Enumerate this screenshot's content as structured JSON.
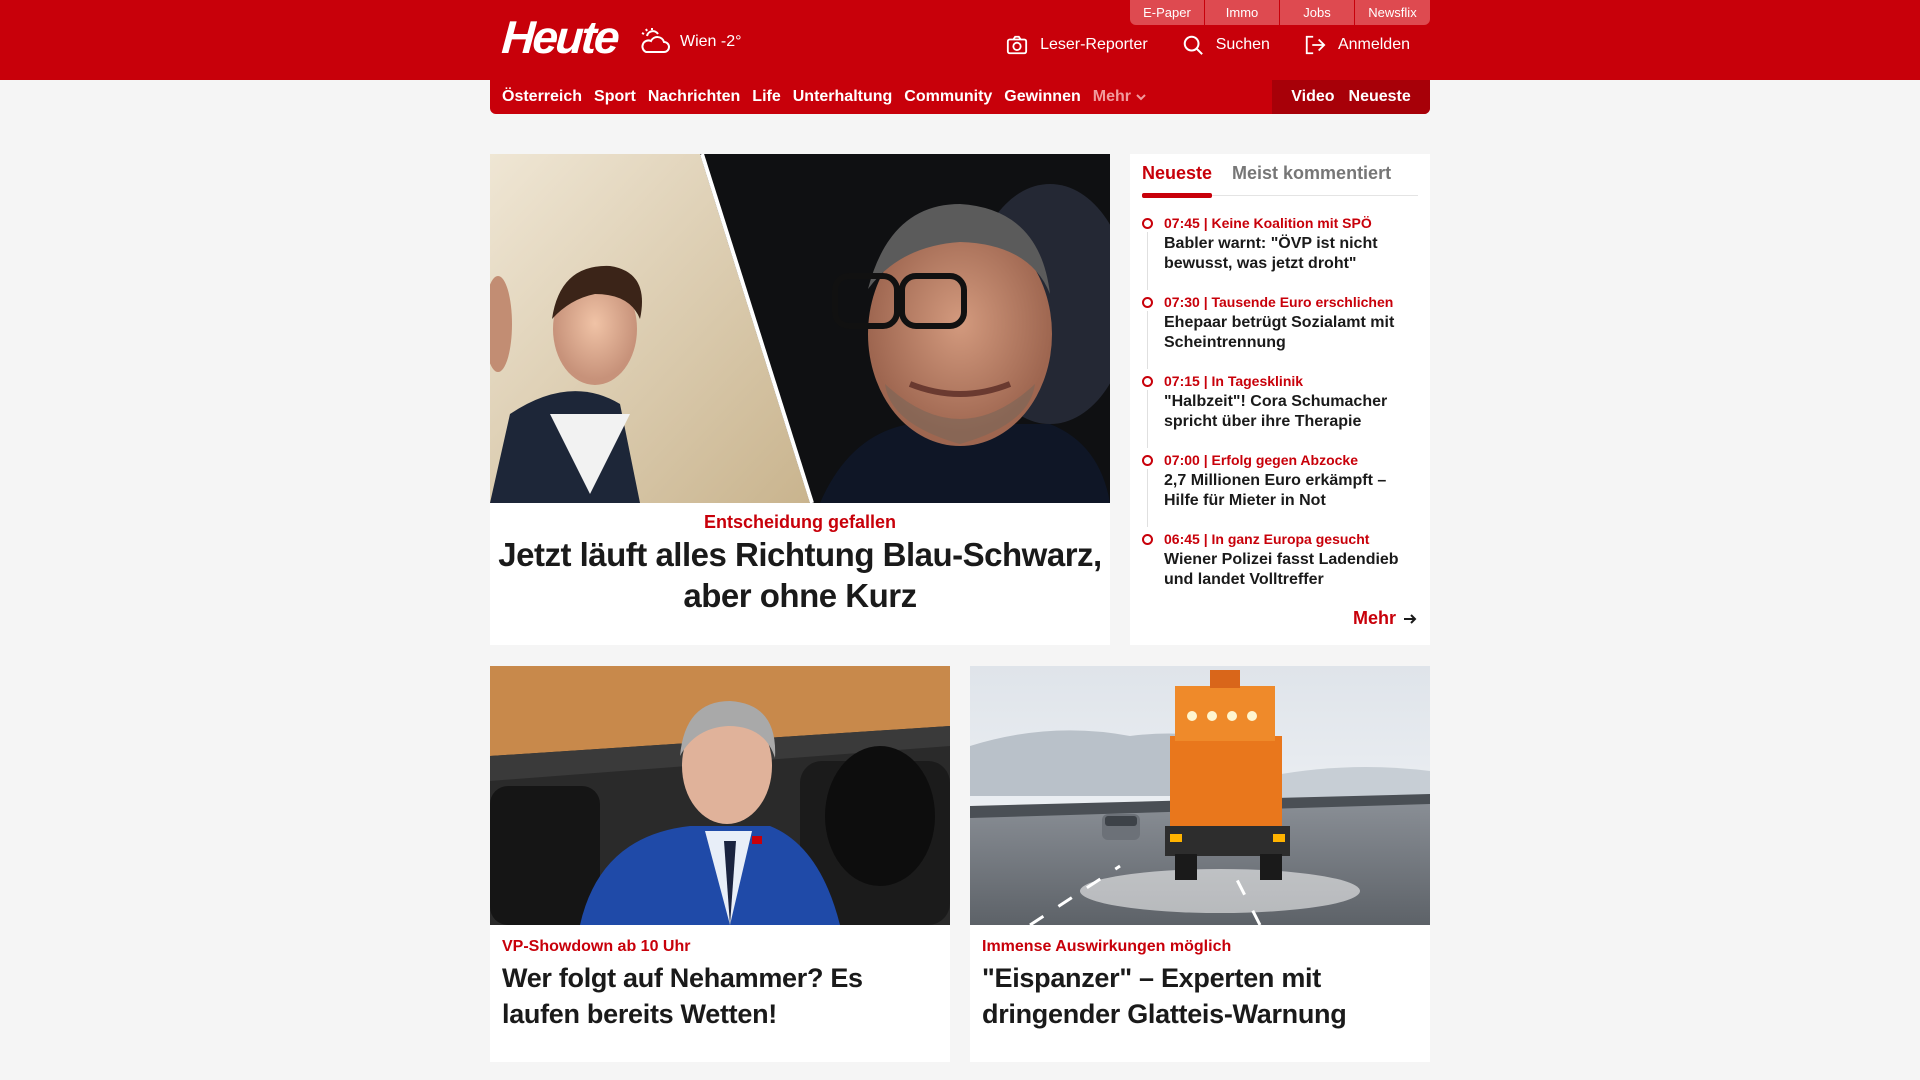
{
  "header": {
    "logo": "Heute",
    "weather": "Wien -2°",
    "utility_tabs": [
      "E-Paper",
      "Immo",
      "Jobs",
      "Newsflix"
    ],
    "actions": {
      "reporter": "Leser-Reporter",
      "search": "Suchen",
      "login": "Anmelden"
    }
  },
  "nav": {
    "items": [
      "Österreich",
      "Sport",
      "Nachrichten",
      "Life",
      "Unterhaltung",
      "Community",
      "Gewinnen"
    ],
    "more": "Mehr",
    "video": "Video",
    "newest": "Neueste"
  },
  "hero": {
    "kicker": "Entscheidung gefallen",
    "title": "Jetzt läuft alles Richtung Blau-Schwarz, aber ohne Kurz"
  },
  "sidebar": {
    "tabs": [
      "Neueste",
      "Meist kommentiert"
    ],
    "items": [
      {
        "meta": "07:45 | Keine Koalition mit SPÖ",
        "title": "Babler warnt: \"ÖVP ist nicht bewusst, was jetzt droht\""
      },
      {
        "meta": "07:30 | Tausende Euro erschlichen",
        "title": "Ehepaar betrügt Sozialamt mit Scheintrennung"
      },
      {
        "meta": "07:15 | In Tagesklinik",
        "title": "\"Halbzeit\"! Cora Schumacher spricht über ihre Therapie"
      },
      {
        "meta": "07:00 | Erfolg gegen Abzocke",
        "title": "2,7 Millionen Euro erkämpft – Hilfe für Mieter in Not"
      },
      {
        "meta": "06:45 | In ganz Europa gesucht",
        "title": "Wiener Polizei fasst Ladendieb und landet Volltreffer"
      }
    ],
    "more": "Mehr"
  },
  "cards": [
    {
      "kicker": "VP-Showdown ab 10 Uhr",
      "title": "Wer folgt auf Nehammer? Es laufen bereits Wetten!"
    },
    {
      "kicker": "Immense Auswirkungen möglich",
      "title": "\"Eispanzer\" – Experten mit dringender Glatteis-Warnung"
    }
  ],
  "colors": {
    "brand_red": "#c8000a",
    "nav_dark_red": "#a70008",
    "utility_tab": "#de4a50",
    "background": "#f5f5f5"
  }
}
